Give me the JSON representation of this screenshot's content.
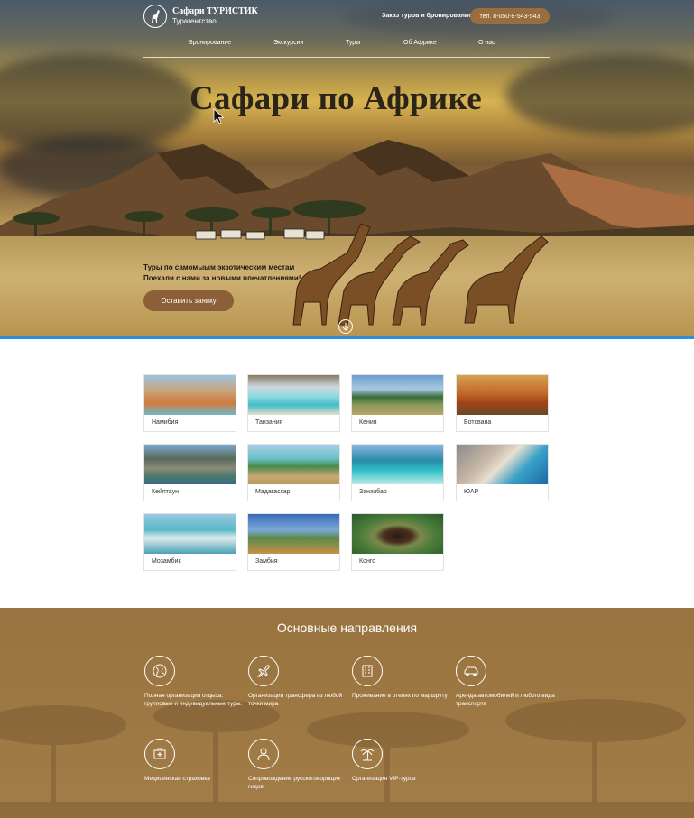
{
  "header": {
    "logo_title": "Сафари ТУРИСТИК",
    "logo_subtitle": "Турагентство",
    "order_label": "Заказ туров и бронирование:",
    "phone": "тел. 8-050-8-543-543"
  },
  "nav": [
    "Бронирование",
    "Экскурсии",
    "Туры",
    "Об Африке",
    "О нас"
  ],
  "hero": {
    "title": "Сафари по Африке",
    "tagline_1": "Туры по самомыым экзотическим местам",
    "tagline_2": "Поехали с нами за новыми впечатлениями!",
    "cta": "Оставить заявку"
  },
  "destinations": [
    "Намибия",
    "Танзания",
    "Кения",
    "Ботсвана",
    "Кейптаун",
    "Мадагаскар",
    "Занзибар",
    "ЮАР",
    "Мозамбик",
    "Замбия",
    "Конго"
  ],
  "directions": {
    "title": "Основные направления",
    "items": [
      {
        "icon": "globe-icon",
        "text": "Полная организация отдыха: групповые и индивидуальные туры."
      },
      {
        "icon": "plane-icon",
        "text": "Организация трансфера из любой точки мира"
      },
      {
        "icon": "hotel-icon",
        "text": "Проживание в отелях по маршруту"
      },
      {
        "icon": "car-icon",
        "text": "Аренда автомобилей и любого вида транспорта"
      },
      {
        "icon": "medical-icon",
        "text": "Медицинская страховка"
      },
      {
        "icon": "guide-icon",
        "text": "Сопровождение русскоговорящих гидов"
      },
      {
        "icon": "palm-icon",
        "text": "Организация VIP-туров"
      }
    ]
  },
  "colors": {
    "accent": "#8b5f37",
    "link_line": "#2f8fd6",
    "section_bg": "#9d7742"
  }
}
